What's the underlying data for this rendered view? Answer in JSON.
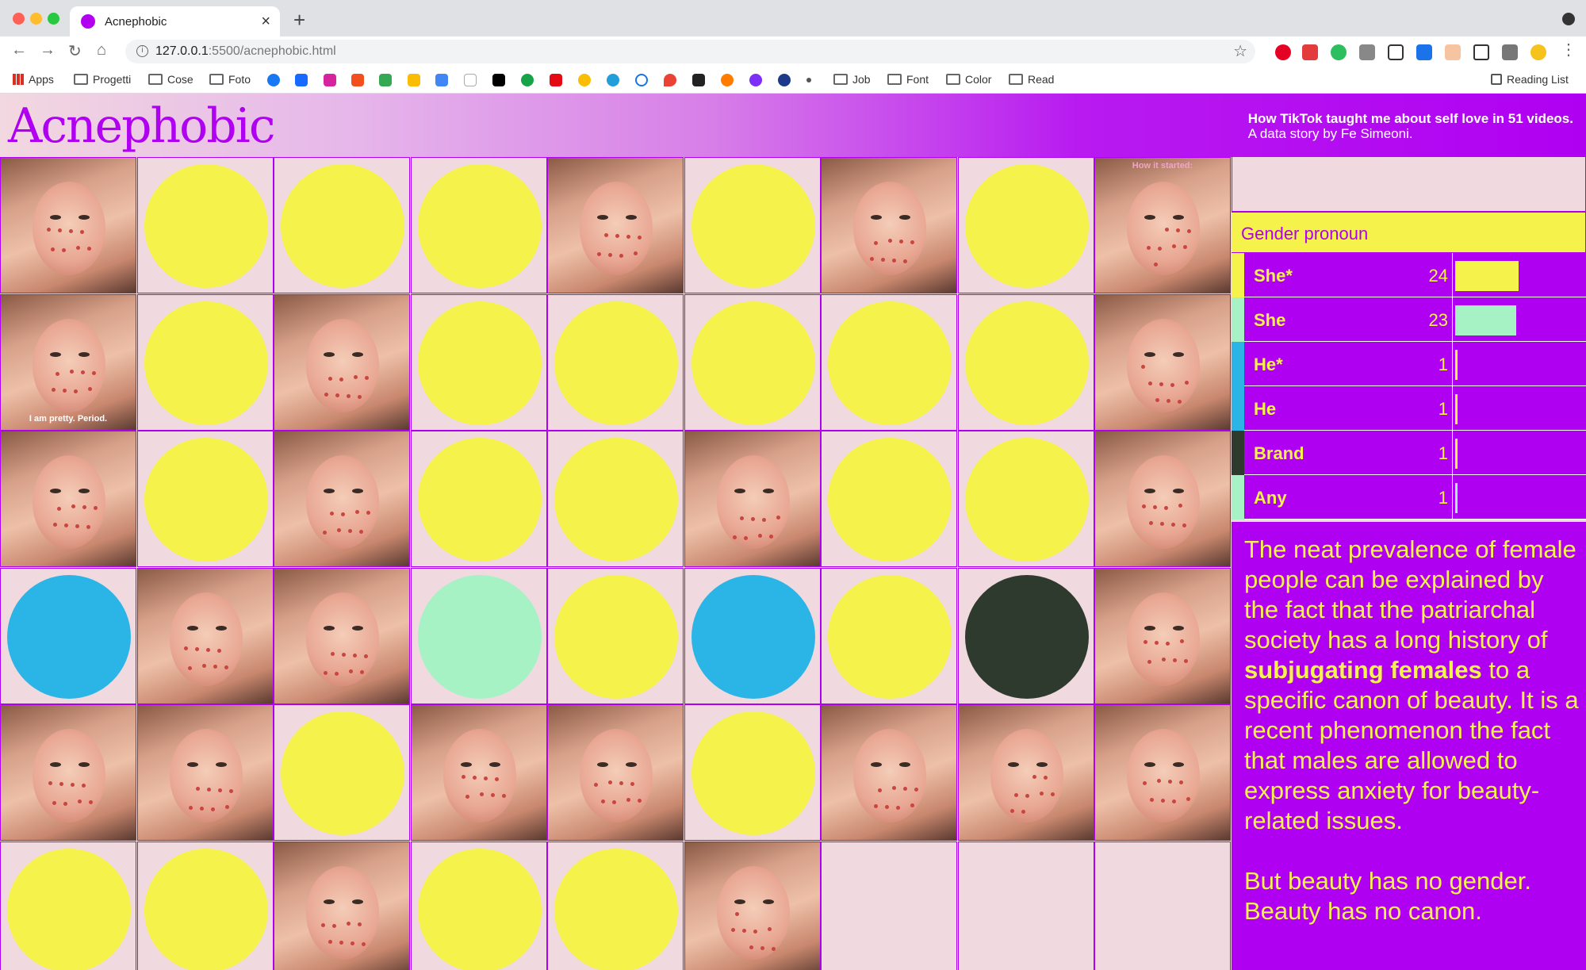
{
  "browser": {
    "tab_title": "Acnephobic",
    "tab_close": "×",
    "new_tab": "+",
    "url_host": "127.0.0.1",
    "url_path": ":5500/acnephobic.html",
    "reading_list": "Reading List",
    "bookmarks": [
      "Apps",
      "Progetti",
      "Cose",
      "Foto",
      "Job",
      "Font",
      "Color",
      "Read"
    ]
  },
  "header": {
    "logo": "Acnephobic",
    "tagline_bold": "How TikTok taught me about self love in 51 videos.",
    "tagline_sub": "A data story by Fe Simeoni."
  },
  "grid": {
    "caption_top": "How it started:",
    "caption_mid": "I am pretty. Period."
  },
  "colors": {
    "purple": "#b000f2",
    "yellow": "#f6f24c",
    "mint": "#a6f2c4",
    "blue": "#2bb5e6",
    "dark": "#2f3a2e",
    "pink": "#f0dae0"
  },
  "panel": {
    "title": "Gender pronoun",
    "rows": [
      {
        "label": "She*",
        "count": "24",
        "value": 24,
        "color": "#f6f24c"
      },
      {
        "label": "She",
        "count": "23",
        "value": 23,
        "color": "#a6f2c4"
      },
      {
        "label": "He*",
        "count": "1",
        "value": 1,
        "color": "#2bb5e6"
      },
      {
        "label": "He",
        "count": "1",
        "value": 1,
        "color": "#2bb5e6"
      },
      {
        "label": "Brand",
        "count": "1",
        "value": 1,
        "color": "#2f3a2e"
      },
      {
        "label": "Any",
        "count": "1",
        "value": 1,
        "color": "#a6f2c4"
      }
    ],
    "para1_a": "The neat prevalence of female people can be explained by the fact that the patriarchal society has a long history of",
    "para1_b": "subjugating females",
    "para1_c": "to a specific canon of beauty. It is a recent phenomenon the fact that males are allowed to express anxiety for beauty-related issues.",
    "para2": "But beauty has no gender. Beauty has no canon."
  }
}
